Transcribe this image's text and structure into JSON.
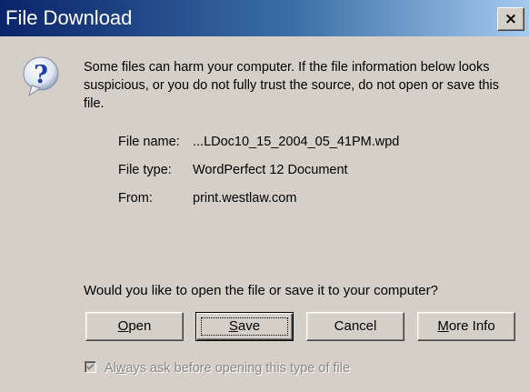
{
  "window": {
    "title": "File Download",
    "close_glyph": "×"
  },
  "icon": {
    "name": "question-icon",
    "glyph": "?",
    "color": "#1c3fae"
  },
  "message": "Some files can harm your computer. If the file information below looks suspicious, or you do not fully trust the source, do not open or save this file.",
  "file_info": {
    "name_label": "File name:",
    "name_value": "...LDoc10_15_2004_05_41PM.wpd",
    "type_label": "File type:",
    "type_value": "WordPerfect 12 Document",
    "from_label": "From:",
    "from_value": "print.westlaw.com"
  },
  "question": "Would you like to open the file or save it to your computer?",
  "buttons": {
    "open": {
      "mnemonic": "O",
      "rest": "pen"
    },
    "save": {
      "mnemonic": "S",
      "rest": "ave"
    },
    "cancel": {
      "label": "Cancel"
    },
    "more_info": {
      "mnemonic": "M",
      "rest": "ore Info"
    }
  },
  "checkbox": {
    "checked": true,
    "enabled": false,
    "before": "Al",
    "mnemonic": "w",
    "after": "ays ask before opening this type of file"
  },
  "colors": {
    "title_gradient_start": "#0a246a",
    "title_gradient_end": "#a6caf0",
    "dialog_face": "#d4d0c8",
    "disabled_text": "#8a8880"
  }
}
